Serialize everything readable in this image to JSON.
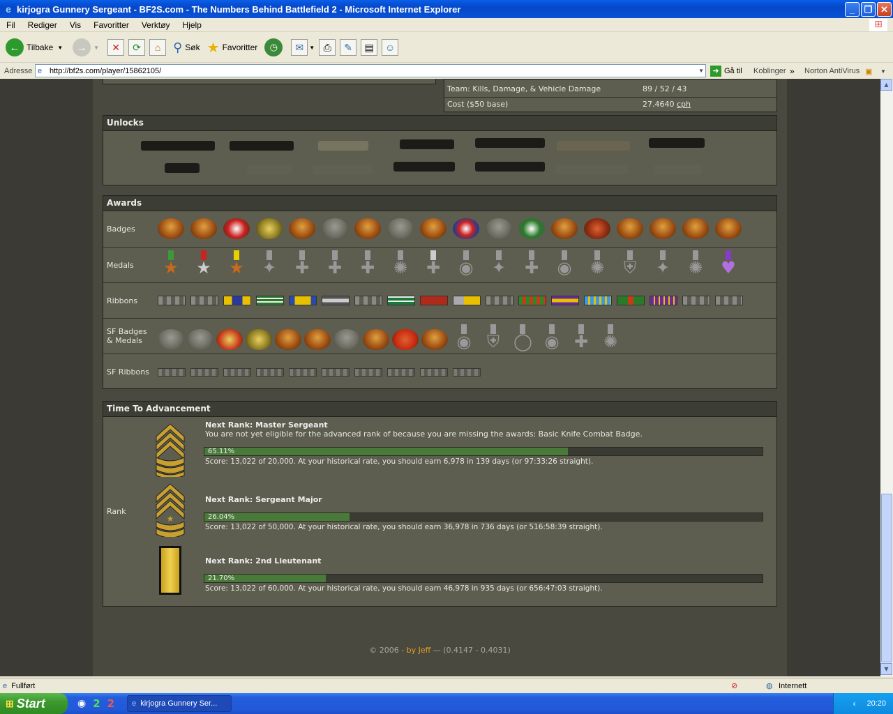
{
  "window": {
    "title": "kirjogra Gunnery Sergeant - BF2S.com - The Numbers Behind Battlefield 2 - Microsoft Internet Explorer"
  },
  "menu": [
    "Fil",
    "Rediger",
    "Vis",
    "Favoritter",
    "Verktøy",
    "Hjelp"
  ],
  "toolbar": {
    "back": "Tilbake",
    "search": "Søk",
    "favorites": "Favoritter"
  },
  "address": {
    "label": "Adresse",
    "url": "http://bf2s.com/player/15862105/",
    "go": "Gå til",
    "links": "Koblinger",
    "norton": "Norton AntiVirus"
  },
  "stats": {
    "team_label": "Team: Kills, Damage, & Vehicle Damage",
    "team_value": "89 / 52 / 43",
    "cost_label": "Cost ($50 base)",
    "cost_value": "27.4640",
    "cost_unit": "cph"
  },
  "unlocks": {
    "title": "Unlocks"
  },
  "awards": {
    "title": "Awards",
    "badges_label": "Badges",
    "medals_label": "Medals",
    "ribbons_label": "Ribbons",
    "sf_badges_label_1": "SF Badges",
    "sf_badges_label_2": "& Medals",
    "sf_ribbons_label": "SF Ribbons"
  },
  "advancement": {
    "title": "Time To Advancement",
    "rank_label": "Rank",
    "items": [
      {
        "title": "Next Rank: Master Sergeant",
        "note": "You are not yet eligible for the advanced rank of because you are missing the awards: Basic Knife Combat Badge.",
        "percent_text": "65.11%",
        "progress": 0.6511,
        "score": "Score: 13,022 of 20,000. At your historical rate, you should earn 6,978 in 139 days (or 97:33:26 straight)."
      },
      {
        "title": "Next Rank: Sergeant Major",
        "note": "",
        "percent_text": "26.04%",
        "progress": 0.2604,
        "score": "Score: 13,022 of 50,000. At your historical rate, you should earn 36,978 in 736 days (or 516:58:39 straight)."
      },
      {
        "title": "Next Rank: 2nd Lieutenant",
        "note": "",
        "percent_text": "21.70%",
        "progress": 0.217,
        "score": "Score: 13,022 of 60,000. At your historical rate, you should earn 46,978 in 935 days (or 656:47:03 straight)."
      }
    ]
  },
  "footer": {
    "copyright": "© 2006 - ",
    "by": "by Jeff",
    "version": " — (0.4147 - 0.4031)"
  },
  "status": {
    "text": "Fullført",
    "zone": "Internett"
  },
  "taskbar": {
    "start": "Start",
    "task": "kirjogra Gunnery Ser...",
    "clock": "20:20"
  },
  "colors": {
    "accent": "#e8a020",
    "progress": "#4a7a3a"
  }
}
